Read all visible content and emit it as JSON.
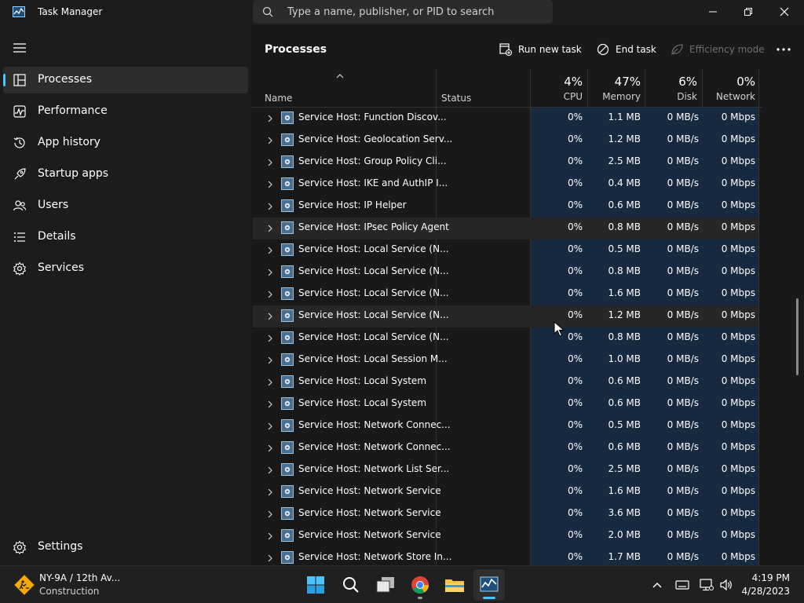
{
  "window": {
    "title": "Task Manager",
    "search_placeholder": "Type a name, publisher, or PID to search"
  },
  "sidebar": {
    "items": [
      {
        "label": "Processes",
        "icon": "processes-icon",
        "active": true
      },
      {
        "label": "Performance",
        "icon": "performance-icon"
      },
      {
        "label": "App history",
        "icon": "app-history-icon"
      },
      {
        "label": "Startup apps",
        "icon": "startup-icon"
      },
      {
        "label": "Users",
        "icon": "users-icon"
      },
      {
        "label": "Details",
        "icon": "details-icon"
      },
      {
        "label": "Services",
        "icon": "services-icon"
      }
    ],
    "settings_label": "Settings"
  },
  "main": {
    "title": "Processes",
    "commands": {
      "run_new_task": "Run new task",
      "end_task": "End task",
      "efficiency_mode": "Efficiency mode"
    }
  },
  "table": {
    "name_header": "Name",
    "status_header": "Status",
    "columns": [
      {
        "pct": "4%",
        "label": "CPU"
      },
      {
        "pct": "47%",
        "label": "Memory"
      },
      {
        "pct": "6%",
        "label": "Disk"
      },
      {
        "pct": "0%",
        "label": "Network"
      }
    ],
    "rows": [
      {
        "name": "Service Host: Function Discov...",
        "cpu": "0%",
        "memory": "1.1 MB",
        "disk": "0 MB/s",
        "network": "0 Mbps"
      },
      {
        "name": "Service Host: Geolocation Serv...",
        "cpu": "0%",
        "memory": "1.2 MB",
        "disk": "0 MB/s",
        "network": "0 Mbps"
      },
      {
        "name": "Service Host: Group Policy Cli...",
        "cpu": "0%",
        "memory": "2.5 MB",
        "disk": "0 MB/s",
        "network": "0 Mbps"
      },
      {
        "name": "Service Host: IKE and AuthIP I...",
        "cpu": "0%",
        "memory": "0.4 MB",
        "disk": "0 MB/s",
        "network": "0 Mbps"
      },
      {
        "name": "Service Host: IP Helper",
        "cpu": "0%",
        "memory": "0.6 MB",
        "disk": "0 MB/s",
        "network": "0 Mbps"
      },
      {
        "name": "Service Host: IPsec Policy Agent",
        "cpu": "0%",
        "memory": "0.8 MB",
        "disk": "0 MB/s",
        "network": "0 Mbps",
        "highlight": true
      },
      {
        "name": "Service Host: Local Service (N...",
        "cpu": "0%",
        "memory": "0.5 MB",
        "disk": "0 MB/s",
        "network": "0 Mbps"
      },
      {
        "name": "Service Host: Local Service (N...",
        "cpu": "0%",
        "memory": "0.8 MB",
        "disk": "0 MB/s",
        "network": "0 Mbps"
      },
      {
        "name": "Service Host: Local Service (N...",
        "cpu": "0%",
        "memory": "1.6 MB",
        "disk": "0 MB/s",
        "network": "0 Mbps"
      },
      {
        "name": "Service Host: Local Service (N...",
        "cpu": "0%",
        "memory": "1.2 MB",
        "disk": "0 MB/s",
        "network": "0 Mbps",
        "highlight": true
      },
      {
        "name": "Service Host: Local Service (N...",
        "cpu": "0%",
        "memory": "0.8 MB",
        "disk": "0 MB/s",
        "network": "0 Mbps"
      },
      {
        "name": "Service Host: Local Session M...",
        "cpu": "0%",
        "memory": "1.0 MB",
        "disk": "0 MB/s",
        "network": "0 Mbps"
      },
      {
        "name": "Service Host: Local System",
        "cpu": "0%",
        "memory": "0.6 MB",
        "disk": "0 MB/s",
        "network": "0 Mbps"
      },
      {
        "name": "Service Host: Local System",
        "cpu": "0%",
        "memory": "0.6 MB",
        "disk": "0 MB/s",
        "network": "0 Mbps"
      },
      {
        "name": "Service Host: Network Connec...",
        "cpu": "0%",
        "memory": "0.5 MB",
        "disk": "0 MB/s",
        "network": "0 Mbps"
      },
      {
        "name": "Service Host: Network Connec...",
        "cpu": "0%",
        "memory": "0.6 MB",
        "disk": "0 MB/s",
        "network": "0 Mbps"
      },
      {
        "name": "Service Host: Network List Ser...",
        "cpu": "0%",
        "memory": "2.5 MB",
        "disk": "0 MB/s",
        "network": "0 Mbps"
      },
      {
        "name": "Service Host: Network Service",
        "cpu": "0%",
        "memory": "1.6 MB",
        "disk": "0 MB/s",
        "network": "0 Mbps"
      },
      {
        "name": "Service Host: Network Service",
        "cpu": "0%",
        "memory": "3.6 MB",
        "disk": "0 MB/s",
        "network": "0 Mbps"
      },
      {
        "name": "Service Host: Network Service",
        "cpu": "0%",
        "memory": "2.0 MB",
        "disk": "0 MB/s",
        "network": "0 Mbps"
      },
      {
        "name": "Service Host: Network Store In...",
        "cpu": "0%",
        "memory": "1.7 MB",
        "disk": "0 MB/s",
        "network": "0 Mbps"
      }
    ]
  },
  "taskbar": {
    "weather_title": "NY-9A / 12th Av...",
    "weather_subtitle": "Construction",
    "time": "4:19 PM",
    "date": "4/28/2023",
    "apps": [
      "windows-start-icon",
      "search-icon",
      "task-view-icon",
      "chrome-icon",
      "file-explorer-icon",
      "task-manager-icon"
    ]
  },
  "colors": {
    "accent": "#4cc2ff",
    "column_tint": "#172a40",
    "background": "#191919"
  }
}
